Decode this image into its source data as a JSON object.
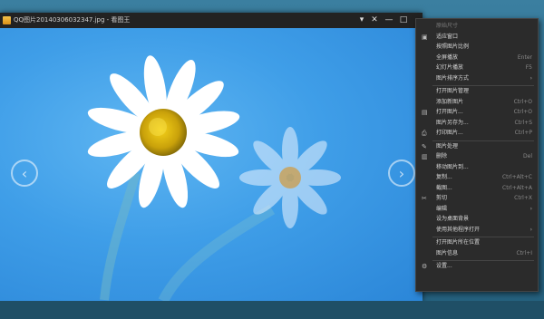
{
  "window": {
    "title": "QQ图片20140306032347.jpg - 看图王"
  },
  "titlebar_controls": [
    "▾",
    "✕",
    "—",
    "□"
  ],
  "nav": {
    "prev": "‹",
    "next": "›"
  },
  "menu": {
    "items": [
      {
        "label": "原始尺寸",
        "shortcut": "",
        "icon": "",
        "disabled": true
      },
      {
        "label": "适应窗口",
        "shortcut": "",
        "icon": "fit-icon"
      },
      {
        "label": "按照图片比例",
        "shortcut": "",
        "icon": ""
      },
      {
        "label": "全屏播放",
        "shortcut": "Enter",
        "icon": ""
      },
      {
        "label": "幻灯片播放",
        "shortcut": "F5",
        "icon": ""
      },
      {
        "label": "图片排序方式",
        "shortcut": "",
        "icon": "",
        "submenu": true
      },
      {
        "sep": true
      },
      {
        "label": "打开图片管理",
        "shortcut": "",
        "icon": ""
      },
      {
        "label": "添加新图片",
        "shortcut": "Ctrl+O",
        "icon": ""
      },
      {
        "label": "打开图片...",
        "shortcut": "Ctrl+O",
        "icon": "folder-icon"
      },
      {
        "label": "图片另存为...",
        "shortcut": "Ctrl+S",
        "icon": ""
      },
      {
        "label": "打印图片...",
        "shortcut": "Ctrl+P",
        "icon": "printer-icon"
      },
      {
        "sep": true
      },
      {
        "label": "图片处理",
        "shortcut": "",
        "icon": "edit-icon"
      },
      {
        "label": "删除",
        "shortcut": "Del",
        "icon": "trash-icon"
      },
      {
        "label": "移动图片到...",
        "shortcut": "",
        "icon": ""
      },
      {
        "label": "复制...",
        "shortcut": "Ctrl+Alt+C",
        "icon": ""
      },
      {
        "label": "截图...",
        "shortcut": "Ctrl+Alt+A",
        "icon": ""
      },
      {
        "label": "剪切",
        "shortcut": "Ctrl+X",
        "icon": "cut-icon"
      },
      {
        "label": "编辑",
        "shortcut": "",
        "icon": "",
        "submenu": true
      },
      {
        "label": "设为桌面背景",
        "shortcut": "",
        "icon": ""
      },
      {
        "label": "使用其他程序打开",
        "shortcut": "",
        "icon": "",
        "submenu": true
      },
      {
        "sep": true
      },
      {
        "label": "打开图片所在位置",
        "shortcut": "",
        "icon": ""
      },
      {
        "label": "图片信息",
        "shortcut": "Ctrl+I",
        "icon": ""
      },
      {
        "sep": true
      },
      {
        "label": "设置...",
        "shortcut": "",
        "icon": "gear-icon"
      }
    ]
  }
}
